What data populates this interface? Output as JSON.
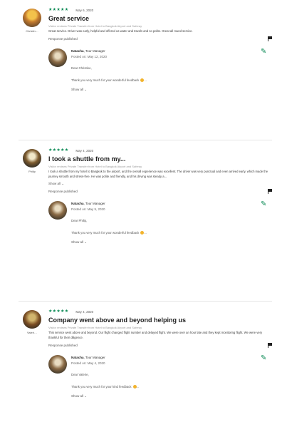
{
  "reviews": [
    {
      "reviewer": "Christin…",
      "stars": "★★★★★",
      "date": "May 6, 2020",
      "title": "Great service",
      "subtitle": "Visitor reviews Private Transfer from Hotel to Bangkok Airport and Saferay",
      "body": "Great service. Driver was early, helpful and offered us water and towels and so polite. Great all round service.",
      "show_all": "",
      "published": "Response published",
      "reply": {
        "name": "Natacha",
        "role": ", Tour Manager",
        "posted": "Posted on: May 12, 2020",
        "dear": "Dear Christine,",
        "text": "Thank you very much for your wonderful feedback",
        "show_all": "Show all ⌄"
      }
    },
    {
      "reviewer": "Philip",
      "stars": "★★★★★",
      "date": "May 4, 2020",
      "title": "I took a shuttle from my...",
      "subtitle": "Visitor reviews Private Transfer from Hotel to Bangkok Airport and Saferay",
      "body": "I took a shuttle from my hotel to Bangkok to the airport, and the overall experience was excellent. The driver was very punctual and even arrived early, which made the journey smooth and stress-free. He was polite and friendly, and his driving was steady a...",
      "show_all": "Show all ⌄",
      "published": "Response published",
      "reply": {
        "name": "Natacha",
        "role": ", Tour Manager",
        "posted": "Posted on: May 5, 2020",
        "dear": "Dear Philip,",
        "text": "Thank you very much for your wonderful feedback",
        "show_all": "Show all ⌄"
      }
    },
    {
      "reviewer": "Valeri…",
      "stars": "★★★★★",
      "date": "May 4, 2020",
      "title": "Company went above and beyond helping us",
      "subtitle": "Visitor reviews Private Transfer from Hotel to Bangkok Airport and Saferay",
      "body": "This service went above and beyond. Our flight changed flight number and delayed flight. We were over an hour late and they kept monitoring flight. We were very thankful for their diligence.",
      "show_all": "",
      "published": "Response published",
      "reply": {
        "name": "Natacha",
        "role": ", Tour Manager",
        "posted": "Posted on: May 4, 2020",
        "dear": "Dear Valerie,",
        "text": "Thank you very much for your kind feedback",
        "show_all": "Show all ⌄"
      }
    }
  ],
  "icons": {
    "flag": "flag-icon",
    "edit": "pencil-icon"
  },
  "colors": {
    "stars": "#0b8a55",
    "edit": "#0b8a55"
  }
}
